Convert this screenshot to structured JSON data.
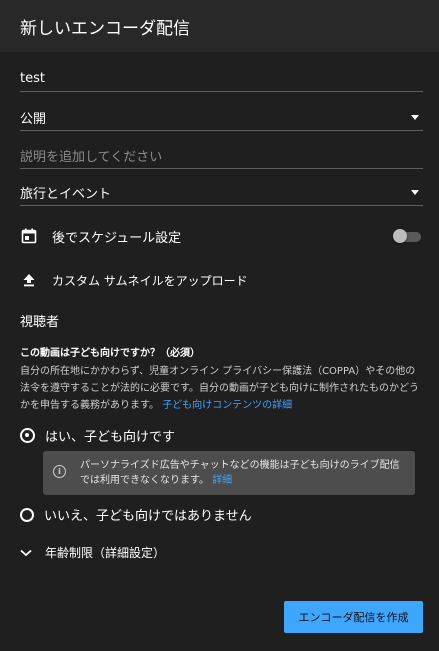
{
  "header": {
    "title": "新しいエンコーダ配信"
  },
  "form": {
    "title_value": "test",
    "visibility_value": "公開",
    "description_placeholder": "説明を追加してください",
    "category_value": "旅行とイベント"
  },
  "schedule": {
    "label": "後でスケジュール設定",
    "enabled": false
  },
  "thumbnail": {
    "label": "カスタム サムネイルをアップロード"
  },
  "audience": {
    "section_title": "視聴者",
    "question": "この動画は子ども向けですか？（必須）",
    "description": "自分の所在地にかかわらず、児童オンライン プライバシー保護法（COPPA）やその他の法令を遵守することが法的に必要です。自分の動画が子ども向けに制作されたものかどうかを申告する義務があります。",
    "description_link": "子ども向けコンテンツの詳細",
    "option_yes": "はい、子ども向けです",
    "info_text": "パーソナライズド広告やチャットなどの機能は子ども向けのライブ配信では利用できなくなります。",
    "info_link": "詳細",
    "option_no": "いいえ、子ども向けではありません"
  },
  "age_restriction": {
    "label": "年齢制限（詳細設定）"
  },
  "footer": {
    "create_label": "エンコーダ配信を作成"
  },
  "colors": {
    "background": "#1f1f1f",
    "header": "#282828",
    "accent": "#3ea6ff",
    "info_box": "#4d4d4d"
  },
  "icons": [
    "calendar-icon",
    "upload-icon",
    "info-icon",
    "chevron-down-icon",
    "dropdown-arrow-icon"
  ]
}
